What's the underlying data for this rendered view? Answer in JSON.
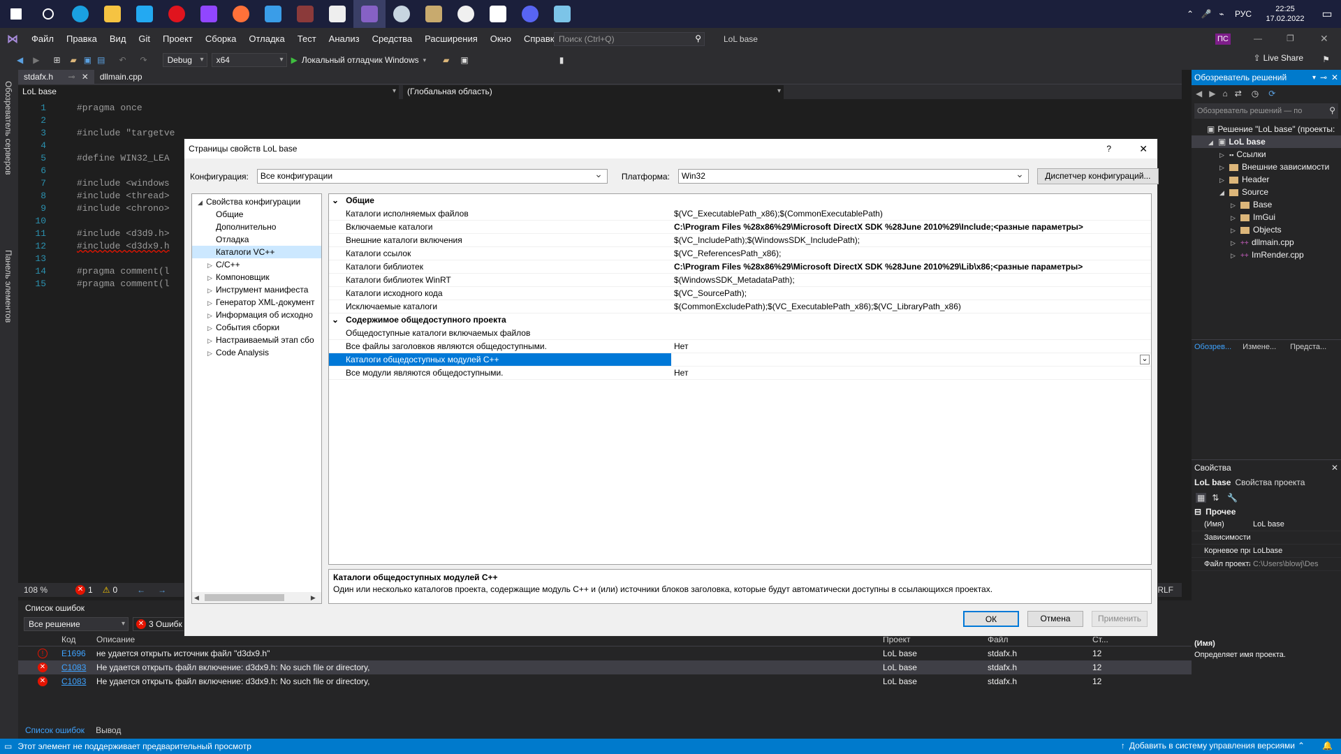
{
  "taskbar": {
    "time": "22:25",
    "date": "17.02.2022",
    "lang": "РУС",
    "icons": [
      "windows-start",
      "search",
      "edge",
      "file-explorer",
      "vscode",
      "opera",
      "twitch",
      "firefox",
      "unknown-app",
      "winrar",
      "pixel-app",
      "visual-studio",
      "steam",
      "league",
      "cat-app",
      "shield-app",
      "discord",
      "glass-app"
    ]
  },
  "menu": {
    "items": [
      "Файл",
      "Правка",
      "Вид",
      "Git",
      "Проект",
      "Сборка",
      "Отладка",
      "Тест",
      "Анализ",
      "Средства",
      "Расширения",
      "Окно",
      "Справка"
    ],
    "search_placeholder": "Поиск (Ctrl+Q)",
    "solution_name": "LoL base",
    "user_initials": "ПС"
  },
  "toolbar": {
    "config": "Debug",
    "platform": "x64",
    "run_label": "Локальный отладчик Windows",
    "live_share": "Live Share"
  },
  "left_tabs": [
    "Обозреватель серверов",
    "Панель элементов"
  ],
  "editor": {
    "tabs": [
      "stdafx.h",
      "dllmain.cpp"
    ],
    "nav_project": "LoL base",
    "nav_scope": "(Глобальная область)",
    "lines": [
      {
        "n": "1",
        "t": "#pragma once"
      },
      {
        "n": "2",
        "t": ""
      },
      {
        "n": "3",
        "t": "#include \"targetve"
      },
      {
        "n": "4",
        "t": ""
      },
      {
        "n": "5",
        "t": "#define WIN32_LEA"
      },
      {
        "n": "6",
        "t": ""
      },
      {
        "n": "7",
        "t": "#include <windows"
      },
      {
        "n": "8",
        "t": "#include <thread>"
      },
      {
        "n": "9",
        "t": "#include <chrono>"
      },
      {
        "n": "10",
        "t": ""
      },
      {
        "n": "11",
        "t": "#include <d3d9.h>"
      },
      {
        "n": "12",
        "t": "#include <d3dx9.h"
      },
      {
        "n": "13",
        "t": ""
      },
      {
        "n": "14",
        "t": "#pragma comment(l"
      },
      {
        "n": "15",
        "t": "#pragma comment(l"
      }
    ],
    "zoom": "108 %",
    "errors_count": "1",
    "warnings_count": "0",
    "line_ending": "CRLF"
  },
  "dialog": {
    "title": "Страницы свойств LoL base",
    "help": "?",
    "config_label": "Конфигурация:",
    "config_value": "Все конфигурации",
    "platform_label": "Платформа:",
    "platform_value": "Win32",
    "config_manager": "Диспетчер конфигураций...",
    "tree": [
      {
        "label": "Свойства конфигурации",
        "level": 0,
        "arrow": "◢",
        "selected": false
      },
      {
        "label": "Общие",
        "level": 1,
        "arrow": "",
        "selected": false
      },
      {
        "label": "Дополнительно",
        "level": 1,
        "arrow": "",
        "selected": false
      },
      {
        "label": "Отладка",
        "level": 1,
        "arrow": "",
        "selected": false
      },
      {
        "label": "Каталоги VC++",
        "level": 1,
        "arrow": "",
        "selected": true
      },
      {
        "label": "C/C++",
        "level": 1,
        "arrow": "▷",
        "selected": false
      },
      {
        "label": "Компоновщик",
        "level": 1,
        "arrow": "▷",
        "selected": false
      },
      {
        "label": "Инструмент манифеста",
        "level": 1,
        "arrow": "▷",
        "selected": false
      },
      {
        "label": "Генератор XML-документ",
        "level": 1,
        "arrow": "▷",
        "selected": false
      },
      {
        "label": "Информация об исходно",
        "level": 1,
        "arrow": "▷",
        "selected": false
      },
      {
        "label": "События сборки",
        "level": 1,
        "arrow": "▷",
        "selected": false
      },
      {
        "label": "Настраиваемый этап сбо",
        "level": 1,
        "arrow": "▷",
        "selected": false
      },
      {
        "label": "Code Analysis",
        "level": 1,
        "arrow": "▷",
        "selected": false
      }
    ],
    "sections": [
      {
        "title": "Общие",
        "rows": [
          {
            "name": "Каталоги исполняемых файлов",
            "value": "$(VC_ExecutablePath_x86);$(CommonExecutablePath)",
            "bold": false
          },
          {
            "name": "Включаемые каталоги",
            "value": "C:\\Program Files %28x86%29\\Microsoft DirectX SDK %28June 2010%29\\Include;<разные параметры>",
            "bold": true
          },
          {
            "name": "Внешние каталоги включения",
            "value": "$(VC_IncludePath);$(WindowsSDK_IncludePath);",
            "bold": false
          },
          {
            "name": "Каталоги ссылок",
            "value": "$(VC_ReferencesPath_x86);",
            "bold": false
          },
          {
            "name": "Каталоги библиотек",
            "value": "C:\\Program Files %28x86%29\\Microsoft DirectX SDK %28June 2010%29\\Lib\\x86;<разные параметры>",
            "bold": true
          },
          {
            "name": "Каталоги библиотек WinRT",
            "value": "$(WindowsSDK_MetadataPath);",
            "bold": false
          },
          {
            "name": "Каталоги исходного кода",
            "value": "$(VC_SourcePath);",
            "bold": false
          },
          {
            "name": "Исключаемые каталоги",
            "value": "$(CommonExcludePath);$(VC_ExecutablePath_x86);$(VC_LibraryPath_x86)",
            "bold": false
          }
        ]
      },
      {
        "title": "Содержимое общедоступного проекта",
        "rows": [
          {
            "name": "Общедоступные каталоги включаемых файлов",
            "value": "",
            "bold": false
          },
          {
            "name": "Все файлы заголовков являются общедоступными.",
            "value": "Нет",
            "bold": false
          },
          {
            "name": "Каталоги общедоступных модулей C++",
            "value": "",
            "bold": false,
            "selected": true
          },
          {
            "name": "Все модули являются общедоступными.",
            "value": "Нет",
            "bold": false
          }
        ]
      }
    ],
    "desc_title": "Каталоги общедоступных модулей C++",
    "desc_text": "Один или несколько каталогов проекта, содержащие модуль C++ и (или) источники блоков заголовка, которые будут автоматически доступны в ссылающихся проектах.",
    "ok": "ОК",
    "cancel": "Отмена",
    "apply": "Применить"
  },
  "errors": {
    "title": "Список ошибок",
    "scope": "Все решение",
    "errors_filter": "3 Ошибк",
    "cols": [
      "Код",
      "Описание",
      "Проект",
      "Файл",
      "Ст..."
    ],
    "rows": [
      {
        "type": "warn",
        "code": "E1696",
        "desc": "не удается открыть источник файл \"d3dx9.h\"",
        "project": "LoL base",
        "file": "stdafx.h",
        "line": "12"
      },
      {
        "type": "err",
        "code": "C1083",
        "desc": "Не удается открыть файл включение: d3dx9.h: No such file or directory,",
        "project": "LoL base",
        "file": "stdafx.h",
        "line": "12"
      },
      {
        "type": "err",
        "code": "C1083",
        "desc": "Не удается открыть файл включение: d3dx9.h: No such file or directory,",
        "project": "LoL base",
        "file": "stdafx.h",
        "line": "12"
      }
    ],
    "tabs": [
      "Список ошибок",
      "Вывод"
    ]
  },
  "solution": {
    "title": "Обозреватель решений",
    "search_placeholder": "Обозреватель решений — по",
    "items": [
      {
        "label": "Решение \"LoL base\" (проекты:",
        "indent": 0,
        "kind": "solution",
        "bold": false
      },
      {
        "label": "LoL base",
        "indent": 1,
        "kind": "project",
        "bold": true
      },
      {
        "label": "Ссылки",
        "indent": 2,
        "kind": "refs",
        "bold": false
      },
      {
        "label": "Внешние зависимости",
        "indent": 2,
        "kind": "folder",
        "bold": false
      },
      {
        "label": "Header",
        "indent": 2,
        "kind": "folder",
        "bold": false
      },
      {
        "label": "Source",
        "indent": 2,
        "kind": "folder",
        "bold": false
      },
      {
        "label": "Base",
        "indent": 3,
        "kind": "folder",
        "bold": false
      },
      {
        "label": "ImGui",
        "indent": 3,
        "kind": "folder",
        "bold": false
      },
      {
        "label": "Objects",
        "indent": 3,
        "kind": "folder",
        "bold": false
      },
      {
        "label": "dllmain.cpp",
        "indent": 3,
        "kind": "cpp",
        "bold": false
      },
      {
        "label": "ImRender.cpp",
        "indent": 3,
        "kind": "cpp",
        "bold": false
      }
    ],
    "bottom_tabs": [
      "Обозрев...",
      "Измене...",
      "Предста..."
    ]
  },
  "properties": {
    "title": "Свойства",
    "object_name": "LoL base",
    "object_type": "Свойства проекта",
    "section": "Прочее",
    "rows": [
      {
        "name": "(Имя)",
        "value": "LoL base"
      },
      {
        "name": "Зависимости",
        "value": ""
      },
      {
        "name": "Корневое про",
        "value": "LoLbase"
      },
      {
        "name": "Файл проекта",
        "value": "C:\\Users\\blowj\\Des"
      }
    ],
    "desc_title": "(Имя)",
    "desc_text": "Определяет имя проекта."
  },
  "status": {
    "left": "Этот элемент не поддерживает предварительный просмотр",
    "right": "Добавить в систему управления версиями",
    "notif": "1"
  },
  "colors": {
    "accent": "#007acc",
    "selection": "#0078d7",
    "error": "#e51400",
    "code_line_number": "#2b91af"
  }
}
